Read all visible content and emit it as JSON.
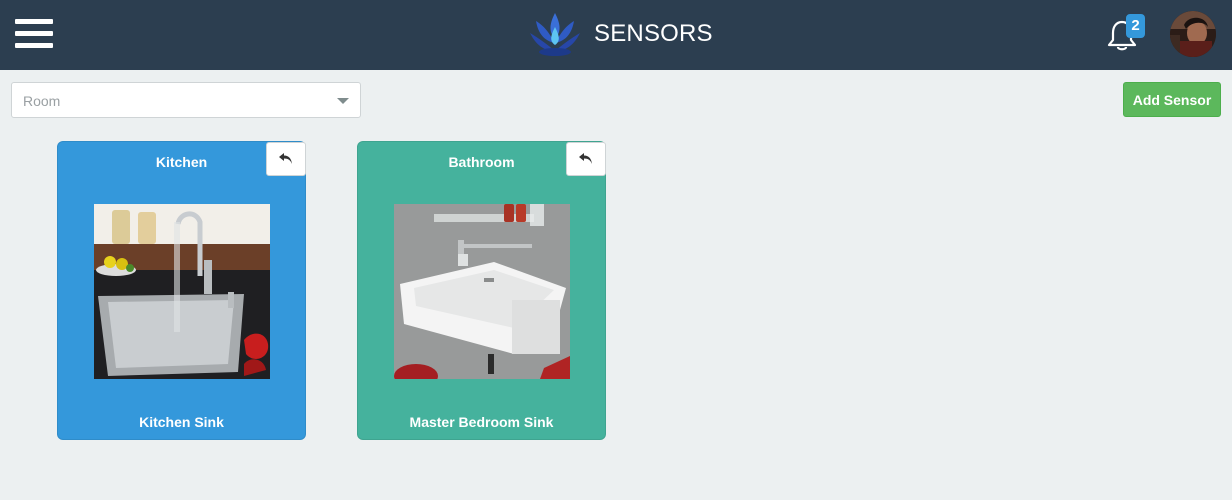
{
  "header": {
    "title": "SENSORS",
    "menu_icon": "hamburger-menu-icon",
    "logo_icon": "water-drop-lotus-logo",
    "notifications_icon": "bell-icon",
    "notification_count": "2"
  },
  "toolbar": {
    "room_placeholder": "Room",
    "add_sensor_label": "Add Sensor"
  },
  "colors": {
    "navbar": "#2c3e50",
    "background": "#ecf0f1",
    "kitchen_card": "#3498db",
    "bathroom_card": "#45b29d",
    "add_button": "#5cb85c",
    "badge": "#3498db"
  },
  "sensors": [
    {
      "room": "Kitchen",
      "name": "Kitchen Sink",
      "image": "kitchen-sink-photo",
      "action_icon": "undo-arrow-icon"
    },
    {
      "room": "Bathroom",
      "name": "Master Bedroom Sink",
      "image": "bathroom-sink-photo",
      "action_icon": "undo-arrow-icon"
    }
  ]
}
